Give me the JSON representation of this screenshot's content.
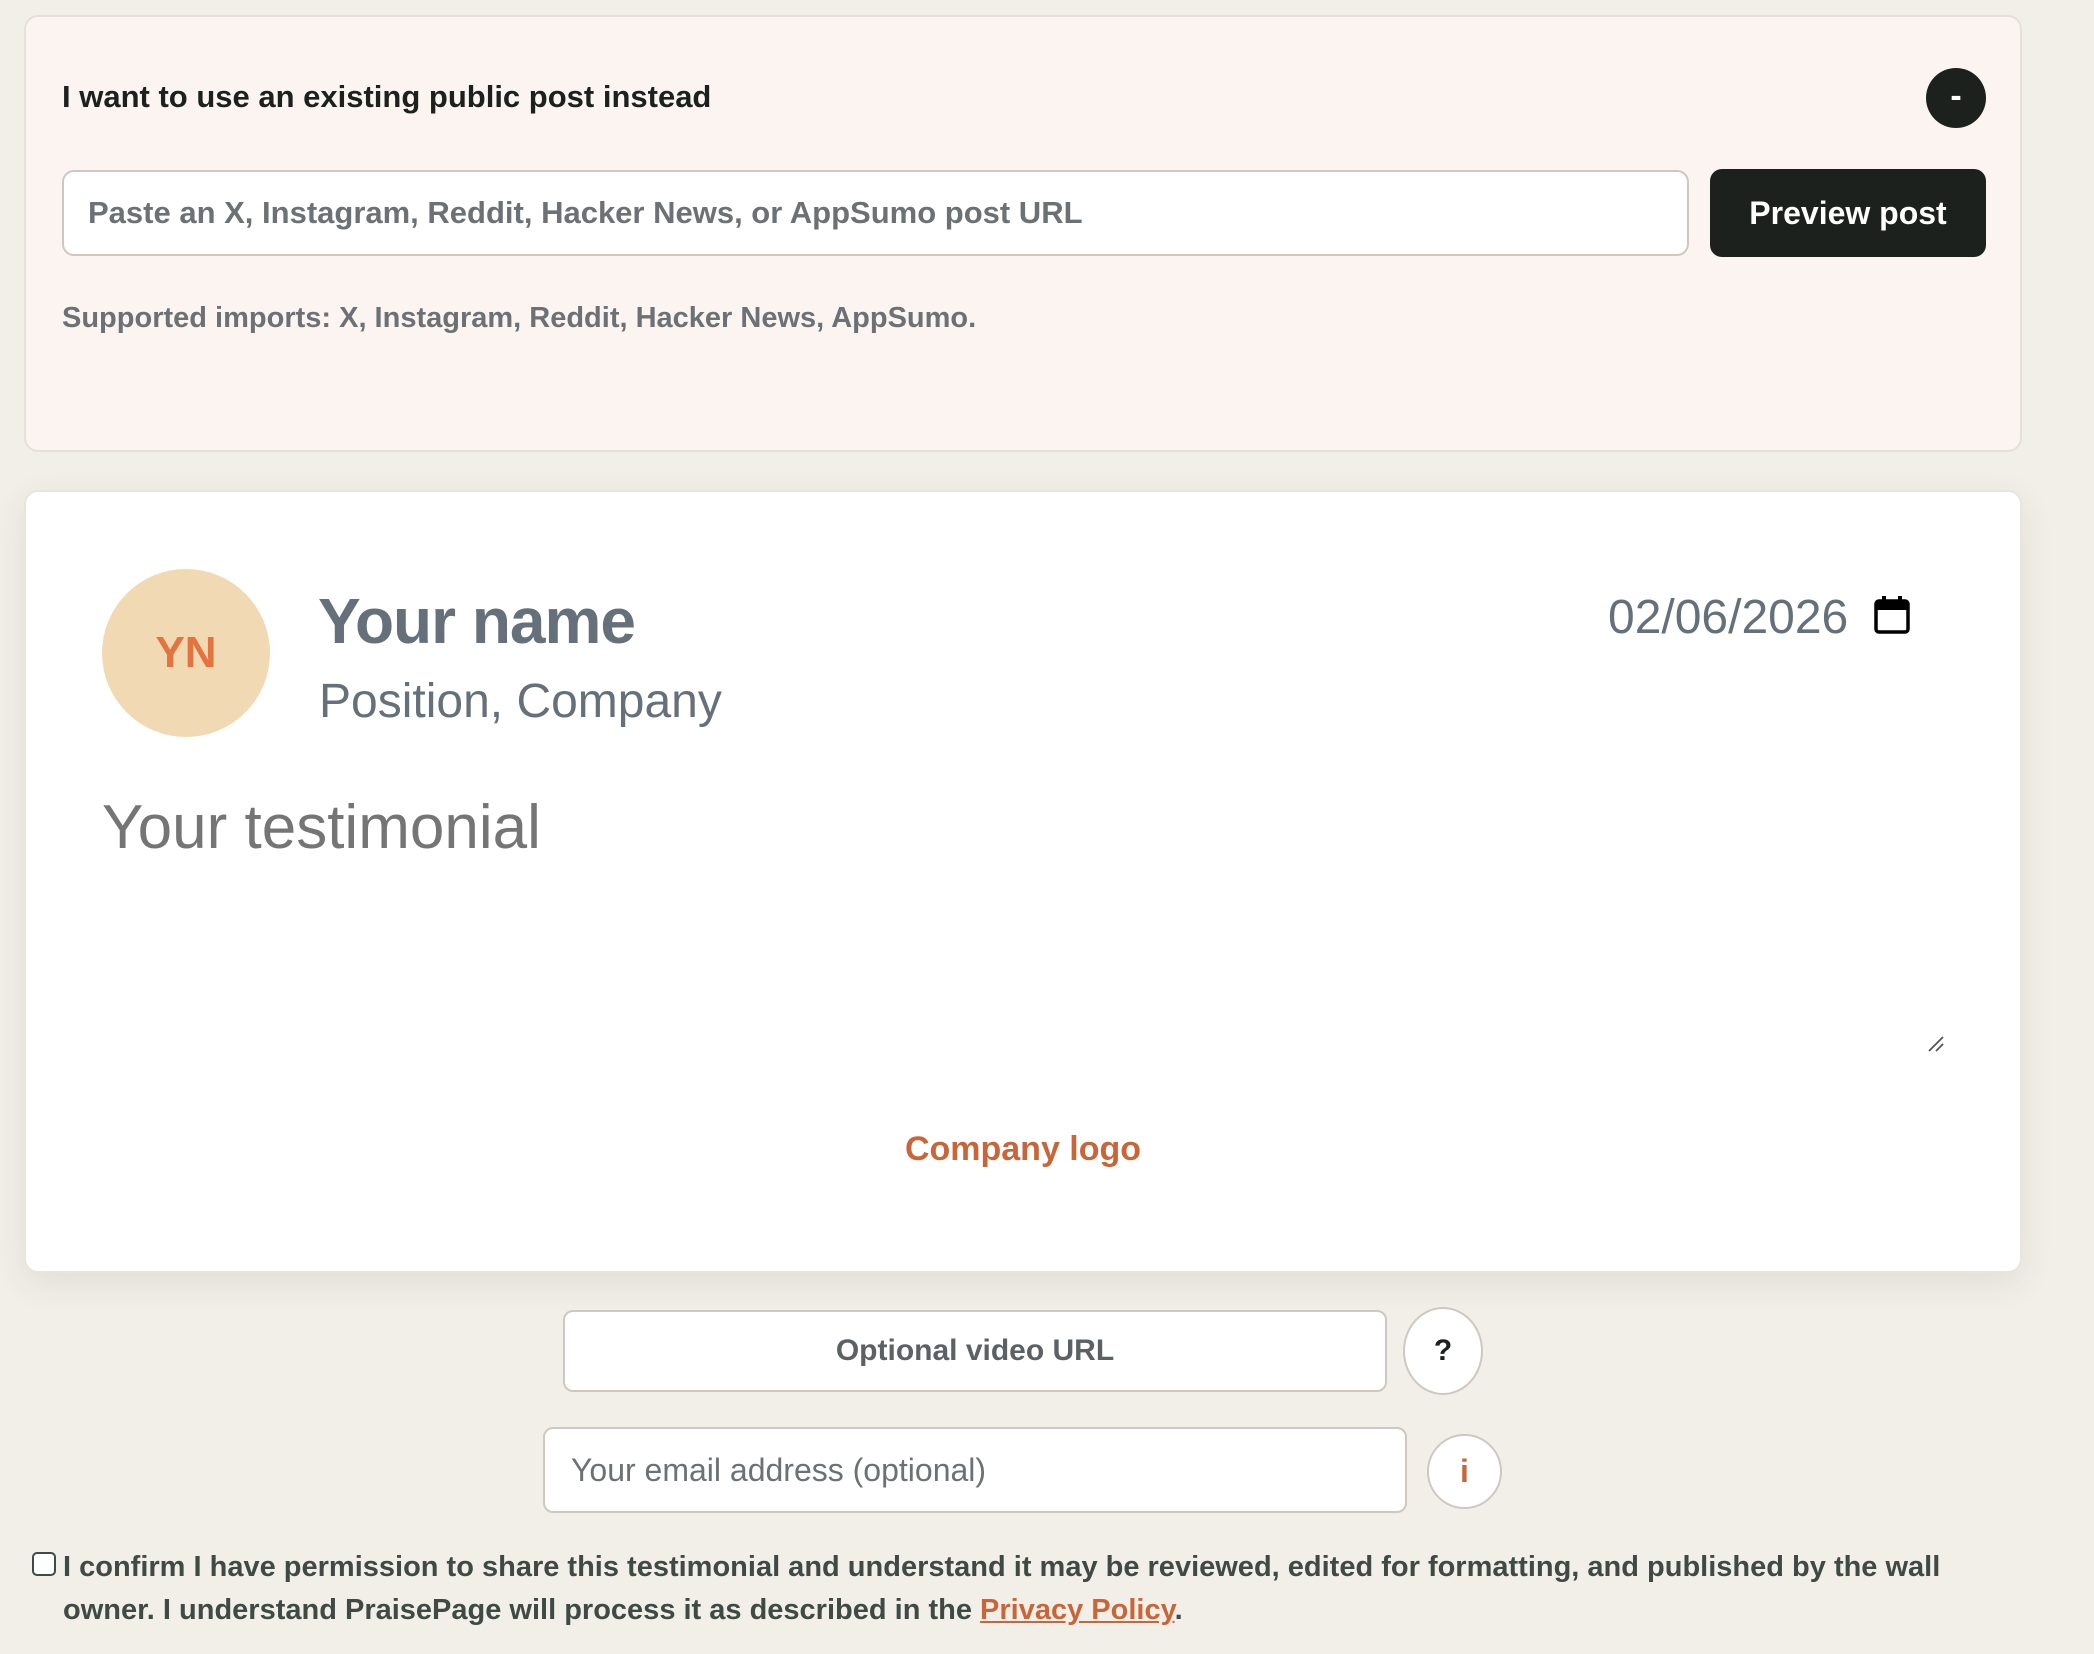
{
  "import_section": {
    "title": "I want to use an existing public post instead",
    "collapse_label": "-",
    "url_placeholder": "Paste an X, Instagram, Reddit, Hacker News, or AppSumo post URL",
    "preview_button": "Preview post",
    "supported_text": "Supported imports: X, Instagram, Reddit, Hacker News, AppSumo."
  },
  "testimonial_card": {
    "avatar_initials": "YN",
    "name": "Your name",
    "position": "Position, Company",
    "date": "02/06/2026",
    "testimonial_placeholder": "Your testimonial",
    "company_logo": "Company logo"
  },
  "video": {
    "label": "Optional video URL",
    "help_label": "?"
  },
  "email": {
    "placeholder": "Your email address (optional)",
    "info_label": "i"
  },
  "consent": {
    "text_before": "I confirm I have permission to share this testimonial and understand it may be reviewed, edited for formatting, and published by the wall owner. I understand PraisePage will process it as described in the ",
    "link_text": "Privacy Policy",
    "text_after": ".",
    "checked": false
  },
  "colors": {
    "page_background": "#f2efe9",
    "import_background": "#fbf4f1",
    "dark": "#1c211e",
    "accent": "#c8663a",
    "avatar_background": "#f1d9b3",
    "avatar_text": "#e3743f",
    "muted_text": "#65707a"
  },
  "icons": {
    "date": "calendar-icon",
    "textarea": "resize-grip-icon"
  }
}
